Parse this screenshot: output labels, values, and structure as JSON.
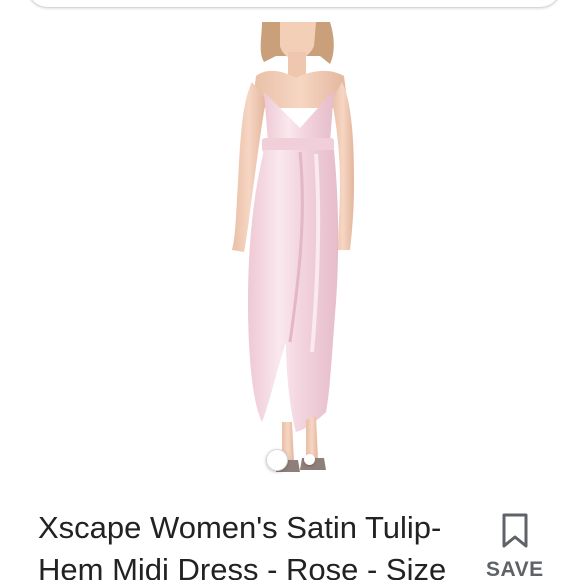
{
  "product": {
    "title": "Xscape Women's Satin Tulip-Hem Midi Dress - Rose - Size",
    "image": {
      "icon": "product-photo",
      "dress_color": "#f4d7e0"
    }
  },
  "carousel": {
    "active_index": 1,
    "total": 2
  },
  "actions": {
    "save_label": "SAVE",
    "save_icon": "bookmark-icon"
  }
}
